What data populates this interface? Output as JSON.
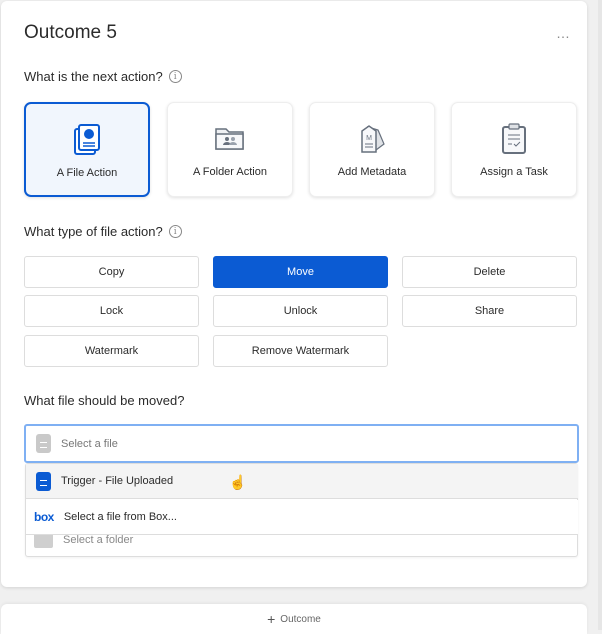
{
  "header": {
    "title": "Outcome 5",
    "more_icon": "…"
  },
  "next_action": {
    "label": "What is the next action?",
    "info_icon": "i",
    "options": [
      {
        "label": "A File Action",
        "icon": "file-report-icon",
        "selected": true
      },
      {
        "label": "A Folder Action",
        "icon": "shared-folder-icon",
        "selected": false
      },
      {
        "label": "Add Metadata",
        "icon": "metadata-tag-icon",
        "selected": false
      },
      {
        "label": "Assign a Task",
        "icon": "clipboard-task-icon",
        "selected": false
      }
    ]
  },
  "file_action": {
    "label": "What type of file action?",
    "info_icon": "i",
    "buttons": [
      {
        "label": "Copy",
        "active": false
      },
      {
        "label": "Move",
        "active": true
      },
      {
        "label": "Delete",
        "active": false
      },
      {
        "label": "Lock",
        "active": false
      },
      {
        "label": "Unlock",
        "active": false
      },
      {
        "label": "Share",
        "active": false
      },
      {
        "label": "Watermark",
        "active": false
      },
      {
        "label": "Remove Watermark",
        "active": false
      }
    ]
  },
  "file_select": {
    "label": "What file should be moved?",
    "placeholder": "Select a file",
    "dropdown": [
      {
        "label": "Trigger - File Uploaded",
        "icon": "blue-file-icon",
        "hovered": true
      },
      {
        "label": "Select a file from Box...",
        "icon": "box-logo-icon",
        "logo_text": "box"
      }
    ],
    "behind_text": "Select a folder"
  },
  "footer": {
    "add_outcome_label": "Outcome",
    "plus": "+"
  },
  "colors": {
    "accent": "#0b5bd3",
    "focus_border": "#7fb0f3"
  }
}
